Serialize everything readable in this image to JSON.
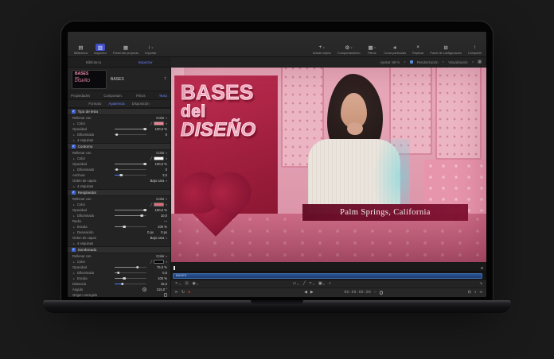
{
  "icons": {
    "library": "▤",
    "inspector": "▥",
    "project": "▦",
    "import": "↓",
    "add": "+",
    "behavior": "⚙",
    "filters": "▩",
    "particles": "∗",
    "replicate": "×",
    "config": "⊞",
    "share": "↑",
    "chev": "∨",
    "caret": "▾",
    "dis": "▸",
    "check": "✓",
    "eyedrop": "╱",
    "grid": "▦",
    "pointer": "↖",
    "adjust": "⊡",
    "mask": "◉",
    "shape": "▭",
    "stroke": "╱",
    "text": "T",
    "image": "▣",
    "close": "×",
    "corner": "↘",
    "tostart": "⇤",
    "loop": "↻",
    "record": "●",
    "prev": "◀",
    "play": "▶",
    "overlay": "⊟",
    "audio": "◖",
    "link": "∞",
    "objtype": "T",
    "minus": "–"
  },
  "header": {
    "left": [
      {
        "label": "Biblioteca"
      },
      {
        "label": "Inspector"
      },
      {
        "label": "Panel del proyecto"
      },
      {
        "label": "Importar"
      }
    ],
    "right": [
      {
        "label": "Añadir objeto"
      },
      {
        "label": "Comportamiento"
      },
      {
        "label": "Filtros"
      },
      {
        "label": "Crear partículas"
      },
      {
        "label": "Replicar"
      },
      {
        "label": "Panel de configuración"
      },
      {
        "label": "Compartir"
      }
    ]
  },
  "panel_tabs": {
    "biblioteca": "Biblioteca",
    "inspector": "Inspector"
  },
  "canvas_bar": {
    "fit": "Ajustar: 68 %",
    "render": "Renderización",
    "view": "Visualización"
  },
  "insp": {
    "object_name": "BASES",
    "thumb": {
      "l1": "BASES",
      "l2": "del",
      "l3": "DISEÑO"
    },
    "tabs": [
      "Propiedades",
      "Comportam.",
      "Filtros",
      "Texto"
    ],
    "subtabs": [
      "Formato",
      "Apariencia",
      "Disposición"
    ],
    "sections": [
      {
        "title": "Tipo de letra",
        "rows": [
          {
            "label": "Rellenar con",
            "value": "Color"
          },
          {
            "label": "Color"
          },
          {
            "label": "Opacidad",
            "value": "100,0 %"
          },
          {
            "label": "Difuminado",
            "value": "0"
          },
          {
            "label": "4 esquinas"
          }
        ]
      },
      {
        "title": "Contorno",
        "rows": [
          {
            "label": "Rellenar con",
            "value": "Color"
          },
          {
            "label": "Color"
          },
          {
            "label": "Opacidad",
            "value": "100,0 %"
          },
          {
            "label": "Difuminado",
            "value": "0"
          },
          {
            "label": "Anchura",
            "value": "3,0"
          },
          {
            "label": "Orden de capas",
            "value": "Bajo cara"
          },
          {
            "label": "4 esquinas"
          }
        ]
      },
      {
        "title": "Resplandor",
        "rows": [
          {
            "label": "Rellenar con",
            "value": "Color"
          },
          {
            "label": "Color"
          },
          {
            "label": "Opacidad",
            "value": "100,0 %"
          },
          {
            "label": "Difuminado",
            "value": "10,0"
          },
          {
            "label": "Radio",
            "value": "—"
          },
          {
            "label": "Escala",
            "value": "100 %"
          },
          {
            "label": "Desviación",
            "value": "0 px",
            "value2": "0 px"
          },
          {
            "label": "Orden de capas",
            "value": "Bajo cara"
          },
          {
            "label": "4 esquinas"
          }
        ]
      },
      {
        "title": "Sombreado",
        "rows": [
          {
            "label": "Rellenar con",
            "value": "Color"
          },
          {
            "label": "Color"
          },
          {
            "label": "Opacidad",
            "value": "75,0 %"
          },
          {
            "label": "Difuminado",
            "value": "0,6"
          },
          {
            "label": "Escala",
            "value": "100 %"
          },
          {
            "label": "Distancia",
            "value": "15,0"
          },
          {
            "label": "Ángulo",
            "value": "315,0 °"
          },
          {
            "label": "Origen corregido"
          }
        ]
      }
    ]
  },
  "swatches": {
    "tipo": "#ee8293",
    "contorno": "#ffffff",
    "resplandor": "#e06a78",
    "sombra": "#060608"
  },
  "canvas": {
    "t1": "BASES",
    "t2": "del",
    "t3": "DISEÑO",
    "caption": "Palm Springs, California"
  },
  "timeline": {
    "track": "BASES",
    "timecode": "00:00:00:00"
  },
  "colors": {
    "accent_blue": "#6b84ff",
    "record_red": "#e0443f",
    "title_pink": "#f2a6bc",
    "banner_maroon": "#6d0d29"
  }
}
